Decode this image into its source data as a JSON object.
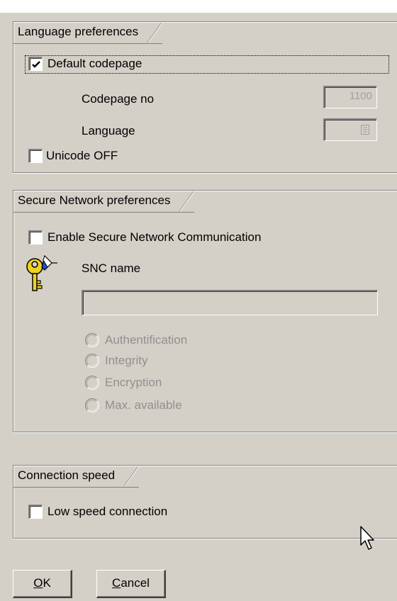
{
  "language_preferences": {
    "title": "Language preferences",
    "default_codepage_label": "Default codepage",
    "default_codepage_checked": true,
    "codepage_no_label": "Codepage no",
    "codepage_no_value": "1100",
    "language_label": "Language",
    "language_value": "",
    "unicode_off_label": "Unicode OFF",
    "unicode_off_checked": false
  },
  "secure_network": {
    "title": "Secure Network preferences",
    "enable_snc_label": "Enable Secure Network Communication",
    "enable_snc_checked": false,
    "icon": "key-icon",
    "snc_name_label": "SNC name",
    "snc_name_value": "",
    "options": [
      {
        "label": "Authentification",
        "enabled": false
      },
      {
        "label": "Integrity",
        "enabled": false
      },
      {
        "label": "Encryption",
        "enabled": false
      },
      {
        "label": "Max. available",
        "enabled": false
      }
    ]
  },
  "connection_speed": {
    "title": "Connection speed",
    "low_speed_label": "Low speed connection",
    "low_speed_checked": false
  },
  "buttons": {
    "ok": {
      "mnemonic": "O",
      "rest": "K"
    },
    "cancel": {
      "mnemonic": "C",
      "rest": "ancel"
    }
  },
  "colors": {
    "dialog_background": "#d4d0c8",
    "disabled_text": "#909090",
    "key_icon": "#f0d020"
  }
}
